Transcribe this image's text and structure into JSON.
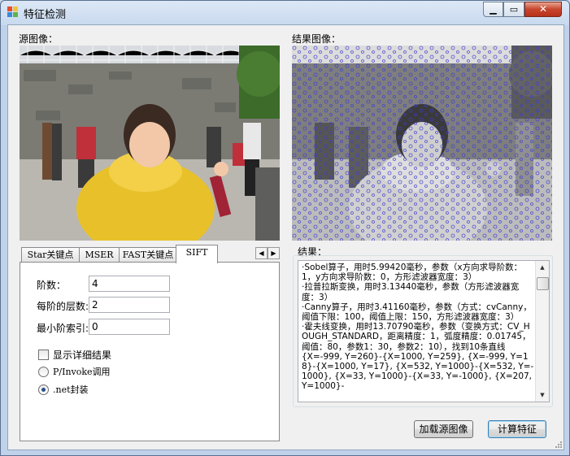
{
  "window": {
    "title": "特征检测"
  },
  "source": {
    "label": "源图像："
  },
  "result_image": {
    "label": "结果图像："
  },
  "tabs": [
    {
      "label": "Star关键点"
    },
    {
      "label": "MSER"
    },
    {
      "label": "FAST关键点"
    },
    {
      "label": "SIFT"
    }
  ],
  "sift": {
    "octaves_label": "阶数：",
    "octaves_value": "4",
    "layers_label": "每阶的层数:",
    "layers_value": "2",
    "min_index_label": "最小阶索引:",
    "min_index_value": "0",
    "show_details_label": "显示详细结果",
    "show_details_checked": false,
    "pinvoke_label": "P/Invoke调用",
    "dotnet_label": ".net封装",
    "selected": "dotnet"
  },
  "results": {
    "label": "结果：",
    "text": "·Sobel算子，用时5.99420毫秒，参数（x方向求导阶数：1，y方向求导阶数：0，方形滤波器宽度：3）\n·拉普拉斯变换，用时3.13440毫秒，参数（方形滤波器宽度：3）\n·Canny算子，用时3.41160毫秒，参数（方式：cvCanny，阈值下限：100，阈值上限：150，方形滤波器宽度：3）\n·霍夫线变换，用时13.70790毫秒，参数（变换方式：CV_HOUGH_STANDARD，距离精度：1，弧度精度：0.01745，阈值：80，参数1：30，参数2：10），找到10条直线\n{X=-999, Y=260}-{X=1000, Y=259}, {X=-999, Y=18}-{X=1000, Y=17}, {X=532, Y=1000}-{X=532, Y=-1000}, {X=33, Y=1000}-{X=33, Y=-1000}, {X=207, Y=1000}-"
  },
  "buttons": {
    "load": "加载源图像",
    "compute": "计算特征"
  },
  "colors": {
    "keypoint": "#3a3ad6",
    "close_button": "#c7452c"
  }
}
